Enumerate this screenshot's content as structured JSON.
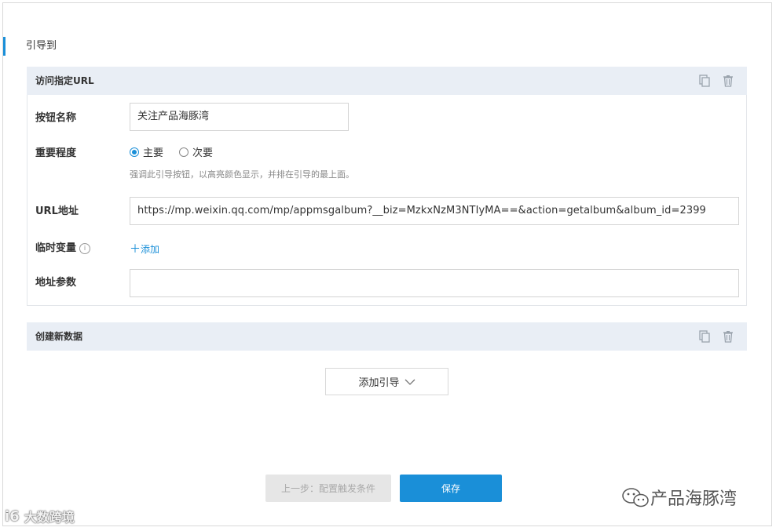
{
  "section": {
    "title": "引导到"
  },
  "card1": {
    "title": "访问指定URL",
    "copy_icon": "copy-icon",
    "delete_icon": "trash-icon",
    "button_name": {
      "label": "按钮名称",
      "value": "关注产品海豚湾"
    },
    "importance": {
      "label": "重要程度",
      "options": [
        {
          "label": "主要",
          "checked": true
        },
        {
          "label": "次要",
          "checked": false
        }
      ],
      "hint": "强调此引导按钮，以高亮颜色显示，并排在引导的最上面。"
    },
    "url": {
      "label": "URL地址",
      "value": "https://mp.weixin.qq.com/mp/appmsgalbum?__biz=MzkxNzM3NTIyMA==&action=getalbum&album_id=2399"
    },
    "temp_var": {
      "label": "临时变量",
      "info_icon": "info-icon",
      "add_label": "添加",
      "add_icon": "plus-icon"
    },
    "addr_params": {
      "label": "地址参数",
      "value": ""
    }
  },
  "card2": {
    "title": "创建新数据",
    "copy_icon": "copy-icon",
    "delete_icon": "trash-icon"
  },
  "add_guide": {
    "label": "添加引导",
    "icon": "chevron-down-icon"
  },
  "footer": {
    "prev_label": "上一步：配置触发条件",
    "save_label": "保存"
  },
  "watermarks": {
    "right": "产品海豚湾",
    "left": "大数跨境",
    "left_prefix": "i6"
  },
  "colors": {
    "accent": "#1a8fd8",
    "header_bg": "#e9eef5",
    "disabled_bg": "#e6e6e6"
  }
}
